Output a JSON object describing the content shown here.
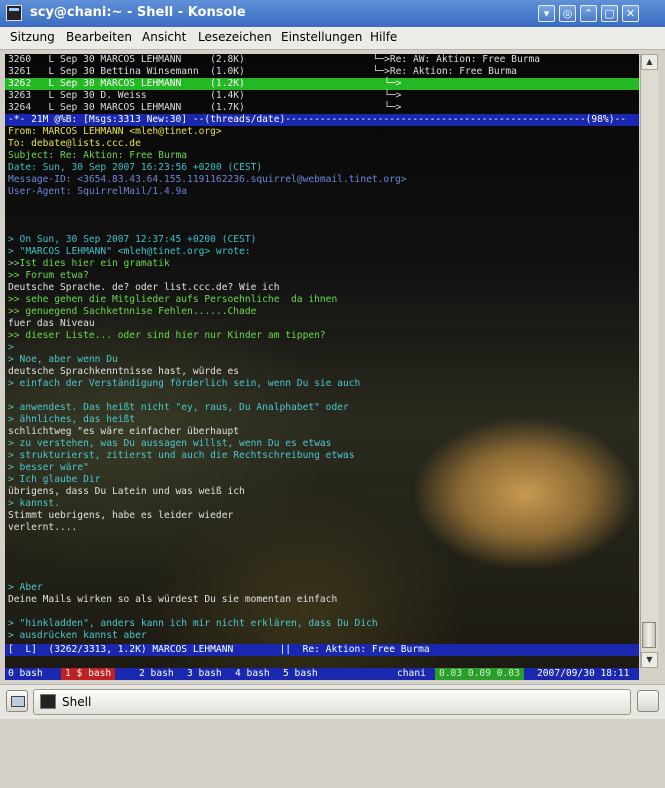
{
  "window": {
    "title": "scy@chani:~ - Shell - Konsole",
    "buttons": [
      "▾",
      "◎",
      "⌃",
      "▢",
      "✕"
    ]
  },
  "menu": [
    "Sitzung",
    "Bearbeiten",
    "Ansicht",
    "Lesezeichen",
    "Einstellungen",
    "Hilfe"
  ],
  "index": [
    {
      "text": "3260   L Sep 30 MARCOS LEHMANN     (2.8K)",
      "thread": "  └─>Re: AW: Aktion: Free Burma",
      "selected": false
    },
    {
      "text": "3261   L Sep 30 Bettina Winsemann  (1.0K)",
      "thread": "  └─>Re: Aktion: Free Burma",
      "selected": false
    },
    {
      "text": "3262   L Sep 30 MARCOS LEHMANN     (1.2K)",
      "thread": "    └─>",
      "selected": true
    },
    {
      "text": "3263   L Sep 30 D. Weiss           (1.4K)",
      "thread": "    └─>",
      "selected": false
    },
    {
      "text": "3264   L Sep 30 MARCOS LEHMANN     (1.7K)",
      "thread": "    └─>",
      "selected": false
    }
  ],
  "status_top": "-*- 21M @%B: [Msgs:3313 New:30] --(threads/date)----------------------------------------------------(98%)--",
  "headers": [
    {
      "text": "From: MARCOS LEHMANN <mleh@tinet.org>",
      "color": "y"
    },
    {
      "text": "To: debate@lists.ccc.de",
      "color": "y"
    },
    {
      "text": "Subject: Re: Aktion: Free Burma",
      "color": "g"
    },
    {
      "text": "Date: Sun, 30 Sep 2007 16:23:56 +0200 (CEST)",
      "color": "c"
    },
    {
      "text": "Message-ID: <3654.83.43.64.155.1191162236.squirrel@webmail.tinet.org>",
      "color": "b"
    },
    {
      "text": "User-Agent: SquirrelMail/1.4.9a",
      "color": "b"
    }
  ],
  "body": [
    {
      "row": 15,
      "text": "> On Sun, 30 Sep 2007 12:37:45 +0200 (CEST)",
      "color": "c"
    },
    {
      "row": 16,
      "text": "> \"MARCOS LEHMANN\" <mleh@tinet.org> wrote:",
      "color": "c"
    },
    {
      "row": 17,
      "text": ">>Ist dies hier ein gramatik",
      "color": "g"
    },
    {
      "row": 18,
      "text": ">> Forum etwa?",
      "color": "g"
    },
    {
      "row": 19,
      "text": "Deutsche Sprache. de? oder list.ccc.de? Wie ich",
      "color": "w"
    },
    {
      "row": 20,
      "text": ">> sehe gehen die Mitglieder aufs Persoehnliche  da ihnen",
      "color": "g"
    },
    {
      "row": 21,
      "text": ">> genuegend Sachketnnise Fehlen......Chade",
      "color": "g"
    },
    {
      "row": 22,
      "text": "fuer das Niveau",
      "color": "w"
    },
    {
      "row": 23,
      "text": ">> dieser Liste... oder sind hier nur Kinder am tippen?",
      "color": "g"
    },
    {
      "row": 24,
      "text": ">",
      "color": "c"
    },
    {
      "row": 25,
      "text": "> Noe, aber wenn Du",
      "color": "cy"
    },
    {
      "row": 26,
      "text": "deutsche Sprachkenntnisse hast, würde es",
      "color": "w"
    },
    {
      "row": 27,
      "text": "> einfach der Verständigung förderlich sein, wenn Du sie auch",
      "color": "cy"
    },
    {
      "row": 29,
      "text": "> anwendest. Das heißt nicht \"ey, raus, Du Analphabet\" oder",
      "color": "cy"
    },
    {
      "row": 30,
      "text": "> ähnliches, das heißt",
      "color": "cy"
    },
    {
      "row": 31,
      "text": "schlichtweg \"es wäre einfacher überhaupt",
      "color": "w"
    },
    {
      "row": 32,
      "text": "> zu verstehen, was Du aussagen willst, wenn Du es etwas",
      "color": "cy"
    },
    {
      "row": 33,
      "text": "> strukturierst, zitierst und auch die Rechtschreibung etwas",
      "color": "cy"
    },
    {
      "row": 34,
      "text": "> besser wäre\"",
      "color": "cy"
    },
    {
      "row": 35,
      "text": "> Ich glaube Dir",
      "color": "cy"
    },
    {
      "row": 36,
      "text": "übrigens, dass Du Latein und was weiß ich",
      "color": "w"
    },
    {
      "row": 37,
      "text": "> kannst.",
      "color": "cy"
    },
    {
      "row": 38,
      "text": "Stimmt uebrigens, habe es leider wieder",
      "color": "w"
    },
    {
      "row": 39,
      "text": "verlernt....",
      "color": "w"
    },
    {
      "row": 44,
      "text": "> Aber",
      "color": "cy"
    },
    {
      "row": 45,
      "text": "Deine Mails wirken so als würdest Du sie momentan einfach",
      "color": "w"
    },
    {
      "row": 47,
      "text": "> \"hinkladden\", anders kann ich mir nicht erklären, dass Du Dich",
      "color": "cy"
    },
    {
      "row": 48,
      "text": "> ausdrücken kannst aber",
      "color": "cy"
    }
  ],
  "status_bottom": "[  L]  (3262/3313, 1.2K) MARCOS LEHMANN        ||  Re: Aktion: Free Burma",
  "screen_tabs": {
    "tabs": [
      "0 bash",
      "1 $ bash",
      "2 bash",
      "3 bash",
      "4 bash",
      "5 bash"
    ],
    "host": "chani",
    "load": "0.03 0.09 0.03",
    "datetime": "2007/09/30 18:11"
  },
  "taskbar": {
    "task_label": "Shell"
  },
  "colors": {
    "selection": "#25b825",
    "statusbar": "#1a28b0",
    "load": "#2aa02a",
    "active_tab": "#c02020"
  }
}
